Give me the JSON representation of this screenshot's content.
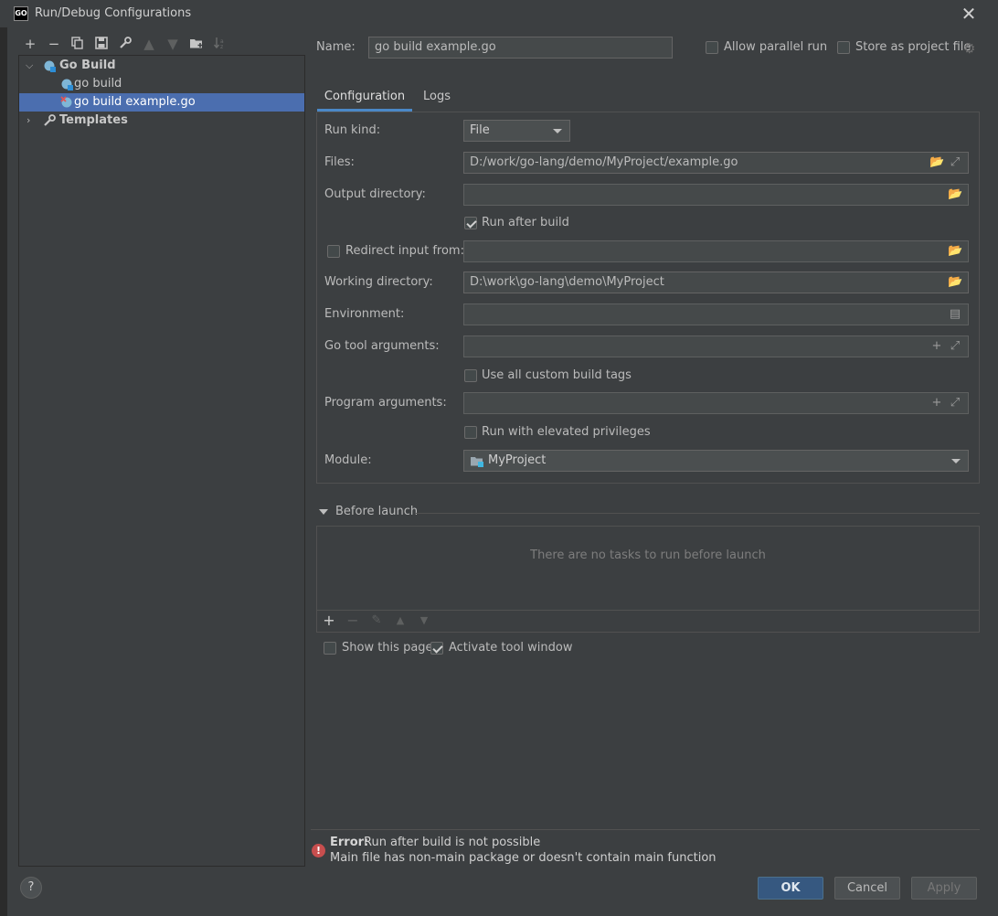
{
  "window": {
    "title": "Run/Debug Configurations"
  },
  "toolbar": {
    "icons": [
      "add-icon",
      "remove-icon",
      "copy-icon",
      "save-icon",
      "wrench-icon",
      "move-up-icon",
      "move-down-icon",
      "new-folder-icon",
      "sort-icon"
    ]
  },
  "tree": {
    "group": "Go Build",
    "items": [
      "go build",
      "go build example.go"
    ],
    "templates": "Templates"
  },
  "header": {
    "name_label": "Name:",
    "name_value": "go build example.go",
    "allow_parallel": "Allow parallel run",
    "store_project": "Store as project file"
  },
  "tabs": {
    "configuration": "Configuration",
    "logs": "Logs"
  },
  "form": {
    "run_kind_label": "Run kind:",
    "run_kind_value": "File",
    "files_label": "Files:",
    "files_value": "D:/work/go-lang/demo/MyProject/example.go",
    "output_dir_label": "Output directory:",
    "output_dir_value": "",
    "run_after_build": "Run after build",
    "redirect_input": "Redirect input from:",
    "working_dir_label": "Working directory:",
    "working_dir_value": "D:\\work\\go-lang\\demo\\MyProject",
    "environment_label": "Environment:",
    "go_tool_args_label": "Go tool arguments:",
    "custom_build_tags": "Use all custom build tags",
    "program_args_label": "Program arguments:",
    "elevated": "Run with elevated privileges",
    "module_label": "Module:",
    "module_value": "MyProject"
  },
  "before_launch": {
    "title": "Before launch",
    "empty": "There are no tasks to run before launch"
  },
  "options": {
    "show_page": "Show this page",
    "activate_tool": "Activate tool window"
  },
  "error": {
    "title": "Error:",
    "message": "Run after build is not possible",
    "detail": "Main file has non-main package or doesn't contain main function"
  },
  "buttons": {
    "help": "?",
    "ok": "OK",
    "cancel": "Cancel",
    "apply": "Apply"
  },
  "colors": {
    "selection": "#4b6eaf",
    "ok_button": "#365880",
    "error": "#c74e4e",
    "tab_underline": "#4a88c7"
  }
}
